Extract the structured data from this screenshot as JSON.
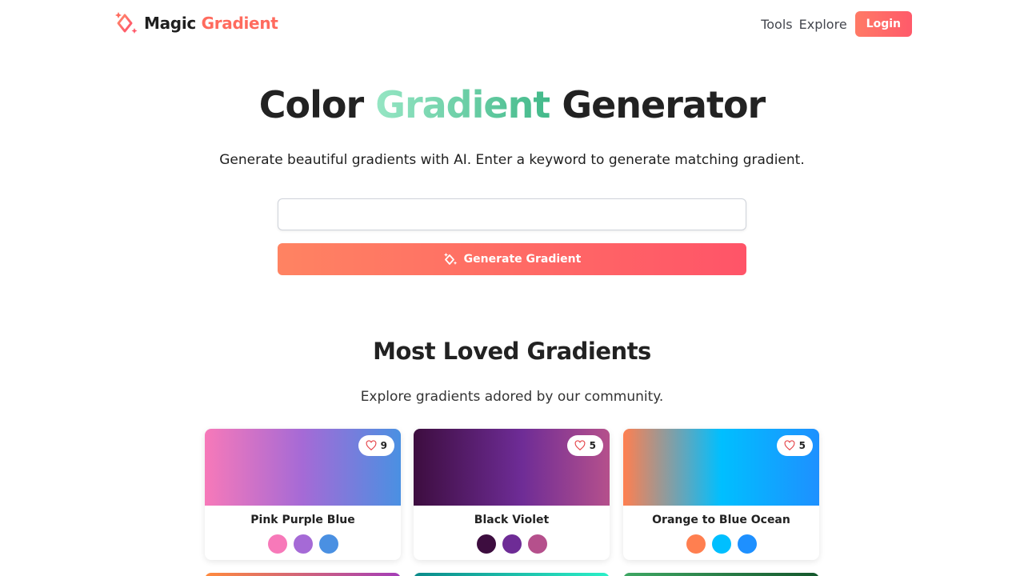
{
  "header": {
    "logo_text": "Magic",
    "logo_accent": "Gradient",
    "nav": [
      "Tools",
      "Explore"
    ],
    "login_label": "Login"
  },
  "hero": {
    "title_pre": "Color",
    "title_accent": "Gradient",
    "title_post": "Generator",
    "subtitle": "Generate beautiful gradients with AI. Enter a keyword to generate matching gradient.",
    "input_value": "",
    "input_placeholder": "",
    "button_label": "Generate Gradient"
  },
  "section": {
    "title": "Most Loved Gradients",
    "subtitle": "Explore gradients adored by our community."
  },
  "colors": {
    "brand": "#ff6b5e",
    "accent_green": "#43b98a"
  },
  "cards": [
    {
      "name": "Pink Purple Blue",
      "likes": "9",
      "colors": [
        "#f779b9",
        "#a56ad6",
        "#4a90e2"
      ]
    },
    {
      "name": "Black Violet",
      "likes": "5",
      "colors": [
        "#3d0d3f",
        "#6e2c96",
        "#b5508c"
      ]
    },
    {
      "name": "Orange to Blue Ocean",
      "likes": "5",
      "colors": [
        "#ff7f50",
        "#00bfff",
        "#1e90ff"
      ]
    }
  ],
  "peek_cards": [
    {
      "colors": [
        "#ff8a3d",
        "#a33db8"
      ]
    },
    {
      "colors": [
        "#0b8a8a",
        "#2cf0c8"
      ]
    },
    {
      "colors": [
        "#3fa864",
        "#14572c"
      ]
    }
  ]
}
